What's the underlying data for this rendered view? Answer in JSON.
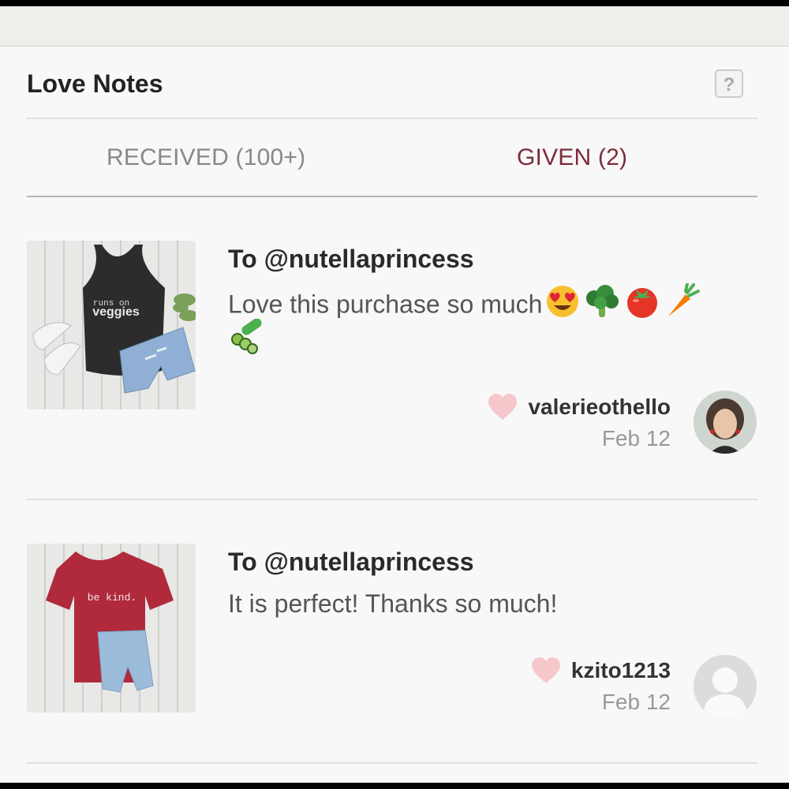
{
  "panel": {
    "title": "Love Notes",
    "help_label": "?"
  },
  "tabs": [
    {
      "label": "RECEIVED",
      "count": "(100+)",
      "active": true
    },
    {
      "label": "GIVEN (2)",
      "active": false
    }
  ],
  "notes": [
    {
      "to": "To @nutellaprincess",
      "message": "Love this purchase so much",
      "emojis": [
        "heart-eyes-emoji",
        "broccoli-emoji",
        "tomato-emoji",
        "carrot-emoji",
        "cucumber-emoji"
      ],
      "username": "valerieothello",
      "date": "Feb 12",
      "product_text": "runs on veggies"
    },
    {
      "to": "To @nutellaprincess",
      "message": "It is perfect! Thanks so much!",
      "username": "kzito1213",
      "date": "Feb 12",
      "product_text": "be kind."
    }
  ],
  "colors": {
    "heart": "#f6c8cc",
    "given_tab": "#7b2d3a",
    "received_tab": "#888888"
  }
}
